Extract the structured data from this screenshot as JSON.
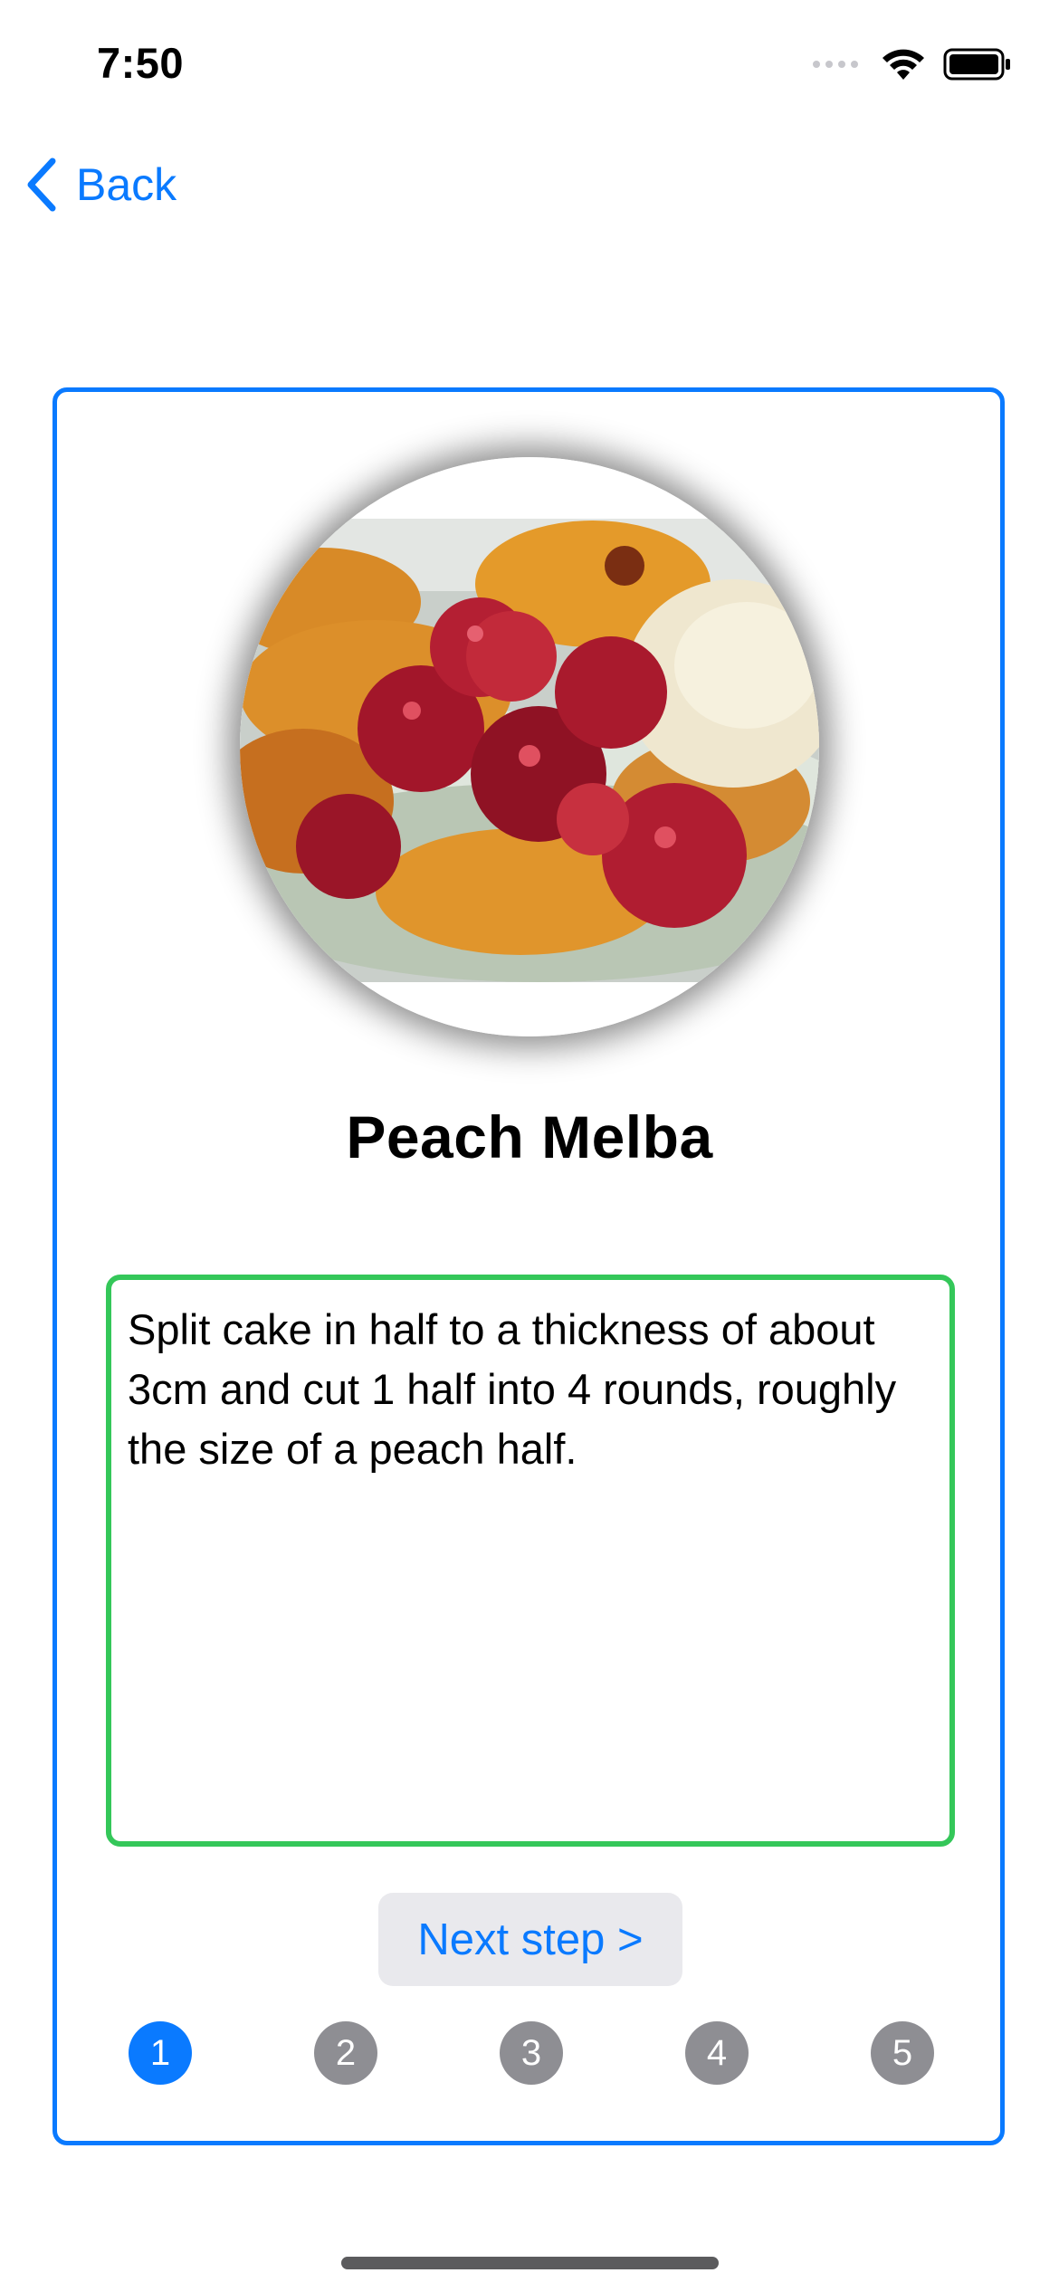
{
  "status_bar": {
    "time": "7:50",
    "icons": [
      "signal-icon",
      "wifi-icon",
      "battery-icon"
    ]
  },
  "nav": {
    "back_label": "Back",
    "back_icon": "chevron-left-icon"
  },
  "recipe": {
    "title": "Peach Melba",
    "image_icon": "peach-melba-photo",
    "step_text": "Split cake in half to a thickness of about 3cm and cut 1 half into 4 rounds, roughly the size of a peach half.",
    "next_label": "Next step >"
  },
  "steps": {
    "items": [
      "1",
      "2",
      "3",
      "4",
      "5"
    ],
    "current": "1"
  },
  "colors": {
    "accent": "#0a7aff",
    "step_border": "#34c759",
    "inactive_dot": "#8e8e93",
    "button_bg": "#e9e9ed"
  }
}
